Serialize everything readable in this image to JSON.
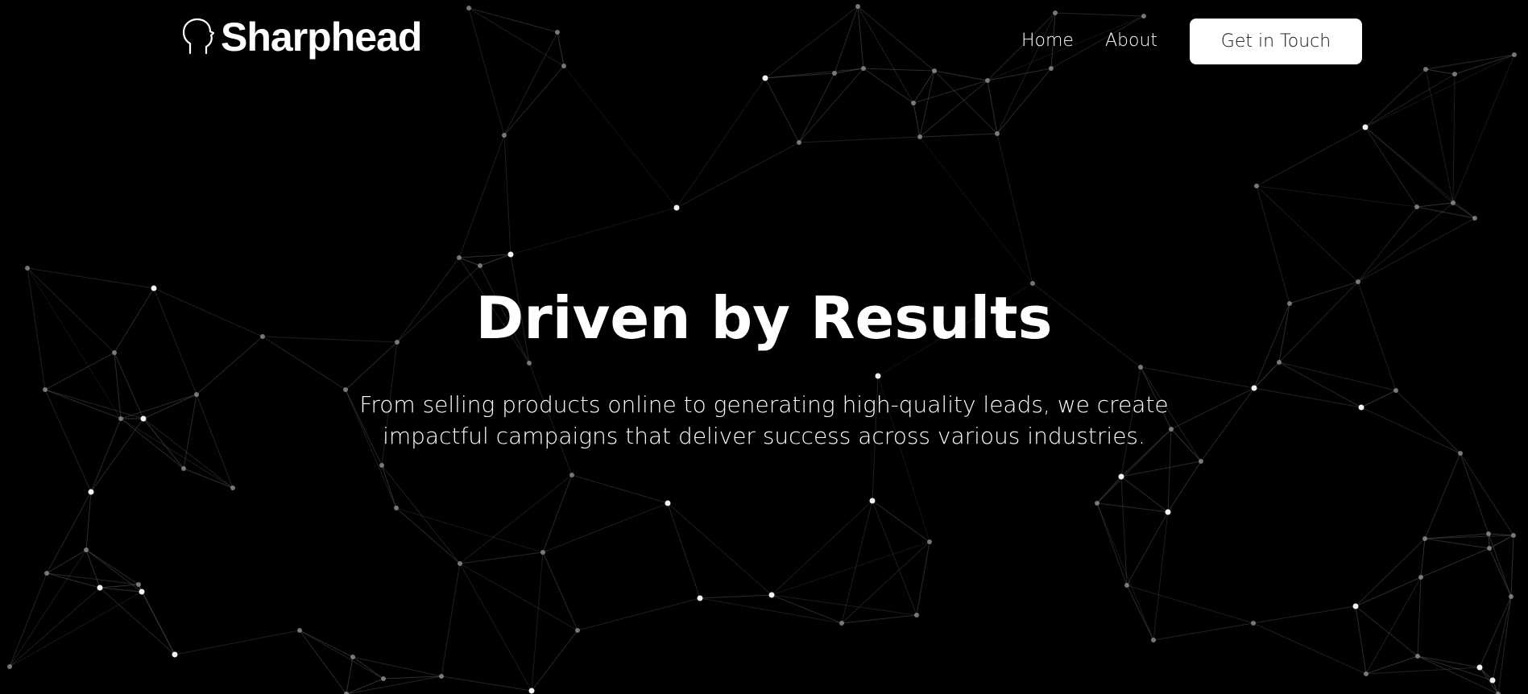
{
  "brand": {
    "name": "Sharphead",
    "logo_icon": "head-silhouette-icon"
  },
  "nav": {
    "home_label": "Home",
    "about_label": "About",
    "cta_label": "Get in Touch"
  },
  "hero": {
    "title": "Driven by Results",
    "subtitle": "From selling products online to generating high-quality leads, we create impactful campaigns that deliver success across various industries."
  },
  "colors": {
    "background": "#000000",
    "text": "#ffffff",
    "cta_background": "#ffffff",
    "cta_text": "#111111",
    "network_line": "#5a5a5a",
    "network_node": "#9a9a9a"
  },
  "background_decoration": "network-constellation"
}
